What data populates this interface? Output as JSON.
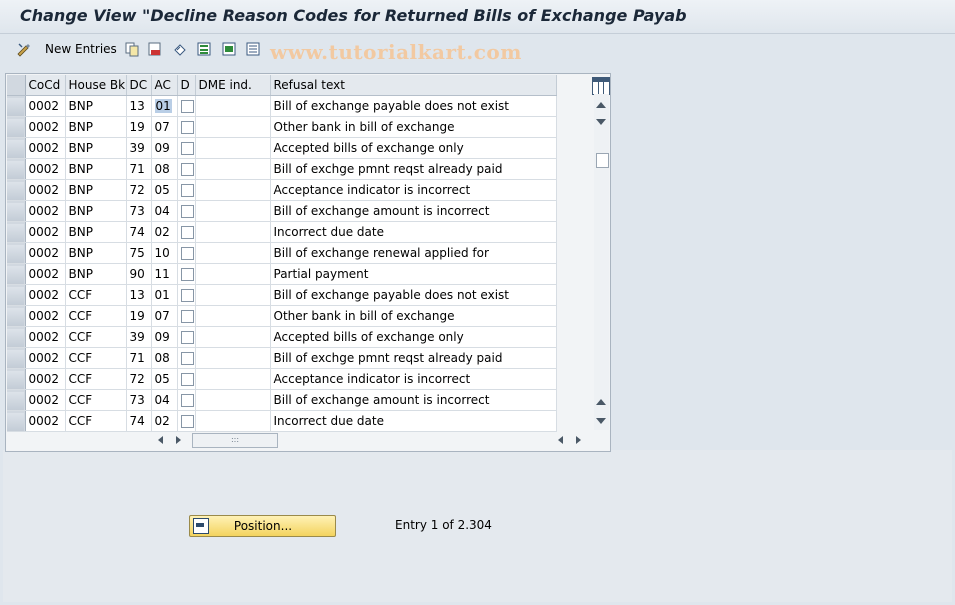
{
  "window": {
    "title": "Change View \"Decline Reason Codes for Returned Bills of Exchange Payab"
  },
  "toolbar": {
    "new_entries_label": "New Entries",
    "icons": [
      "display-change-icon",
      "copy-icon",
      "delete-icon",
      "undo-icon",
      "select-all-icon",
      "select-block-icon",
      "deselect-all-icon"
    ]
  },
  "watermark": "www.tutorialkart.com",
  "table": {
    "columns": [
      "CoCd",
      "House Bk",
      "DC",
      "AC",
      "D",
      "DME ind.",
      "Refusal text"
    ],
    "rows": [
      {
        "cocd": "0002",
        "house_bk": "BNP",
        "dc": "13",
        "ac": "01",
        "refusal": "Bill of exchange payable does not exist"
      },
      {
        "cocd": "0002",
        "house_bk": "BNP",
        "dc": "19",
        "ac": "07",
        "refusal": "Other bank in bill of exchange"
      },
      {
        "cocd": "0002",
        "house_bk": "BNP",
        "dc": "39",
        "ac": "09",
        "refusal": "Accepted bills of exchange only"
      },
      {
        "cocd": "0002",
        "house_bk": "BNP",
        "dc": "71",
        "ac": "08",
        "refusal": "Bill of exchge pmnt reqst already paid"
      },
      {
        "cocd": "0002",
        "house_bk": "BNP",
        "dc": "72",
        "ac": "05",
        "refusal": "Acceptance indicator is incorrect"
      },
      {
        "cocd": "0002",
        "house_bk": "BNP",
        "dc": "73",
        "ac": "04",
        "refusal": "Bill of exchange amount is incorrect"
      },
      {
        "cocd": "0002",
        "house_bk": "BNP",
        "dc": "74",
        "ac": "02",
        "refusal": "Incorrect due date"
      },
      {
        "cocd": "0002",
        "house_bk": "BNP",
        "dc": "75",
        "ac": "10",
        "refusal": "Bill of exchange renewal applied for"
      },
      {
        "cocd": "0002",
        "house_bk": "BNP",
        "dc": "90",
        "ac": "11",
        "refusal": "Partial payment"
      },
      {
        "cocd": "0002",
        "house_bk": "CCF",
        "dc": "13",
        "ac": "01",
        "refusal": "Bill of exchange payable does not exist"
      },
      {
        "cocd": "0002",
        "house_bk": "CCF",
        "dc": "19",
        "ac": "07",
        "refusal": "Other bank in bill of exchange"
      },
      {
        "cocd": "0002",
        "house_bk": "CCF",
        "dc": "39",
        "ac": "09",
        "refusal": "Accepted bills of exchange only"
      },
      {
        "cocd": "0002",
        "house_bk": "CCF",
        "dc": "71",
        "ac": "08",
        "refusal": "Bill of exchge pmnt reqst already paid"
      },
      {
        "cocd": "0002",
        "house_bk": "CCF",
        "dc": "72",
        "ac": "05",
        "refusal": "Acceptance indicator is incorrect"
      },
      {
        "cocd": "0002",
        "house_bk": "CCF",
        "dc": "73",
        "ac": "04",
        "refusal": "Bill of exchange amount is incorrect"
      },
      {
        "cocd": "0002",
        "house_bk": "CCF",
        "dc": "74",
        "ac": "02",
        "refusal": "Incorrect due date"
      }
    ]
  },
  "position_button": {
    "label": "Position..."
  },
  "entry_info": "Entry 1 of 2.304",
  "colors": {
    "accent_button": "#f3d35e",
    "header_bg": "#e4e9ee",
    "watermark": "#f2c9a1"
  }
}
